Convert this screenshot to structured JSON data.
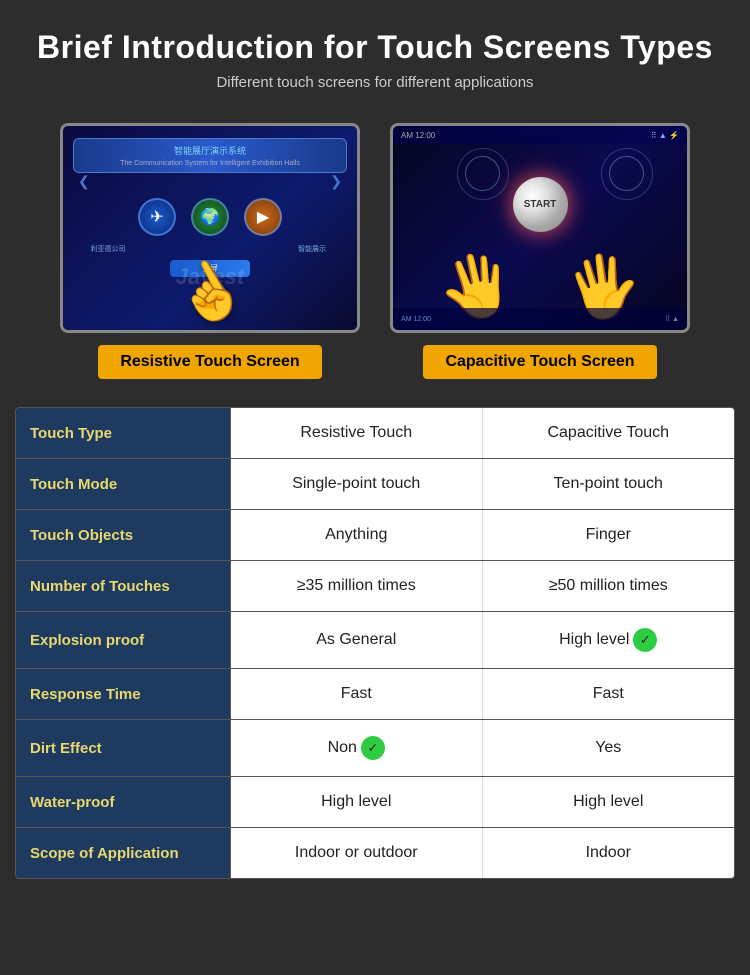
{
  "header": {
    "title": "Brief Introduction for Touch Screens Types",
    "subtitle": "Different touch screens for different applications"
  },
  "screens": [
    {
      "id": "resistive",
      "label": "Resistive Touch Screen",
      "type": "resistive"
    },
    {
      "id": "capacitive",
      "label": "Capacitive Touch Screen",
      "type": "capacitive"
    }
  ],
  "watermark": "Jayest",
  "table": {
    "headers": [
      "",
      "Resistive Touch",
      "Capacitive Touch"
    ],
    "rows": [
      {
        "label": "Touch Type",
        "resistive": "Resistive Touch",
        "capacitive": "Capacitive Touch",
        "resistive_extra": "",
        "capacitive_extra": ""
      },
      {
        "label": "Touch Mode",
        "resistive": "Single-point touch",
        "capacitive": "Ten-point touch",
        "resistive_extra": "",
        "capacitive_extra": ""
      },
      {
        "label": "Touch Objects",
        "resistive": "Anything",
        "capacitive": "Finger",
        "resistive_extra": "",
        "capacitive_extra": ""
      },
      {
        "label": "Number of Touches",
        "resistive": "≥35 million times",
        "capacitive": "≥50 million times",
        "resistive_extra": "",
        "capacitive_extra": ""
      },
      {
        "label": "Explosion proof",
        "resistive": "As General",
        "capacitive": "High level",
        "resistive_extra": "",
        "capacitive_extra": "badge"
      },
      {
        "label": "Response Time",
        "resistive": "Fast",
        "capacitive": "Fast",
        "resistive_extra": "",
        "capacitive_extra": ""
      },
      {
        "label": "Dirt Effect",
        "resistive": "Non",
        "capacitive": "Yes",
        "resistive_extra": "badge",
        "capacitive_extra": ""
      },
      {
        "label": "Water-proof",
        "resistive": "High level",
        "capacitive": "High level",
        "resistive_extra": "",
        "capacitive_extra": ""
      },
      {
        "label": "Scope of Application",
        "resistive": "Indoor or outdoor",
        "capacitive": "Indoor",
        "resistive_extra": "",
        "capacitive_extra": ""
      }
    ]
  }
}
